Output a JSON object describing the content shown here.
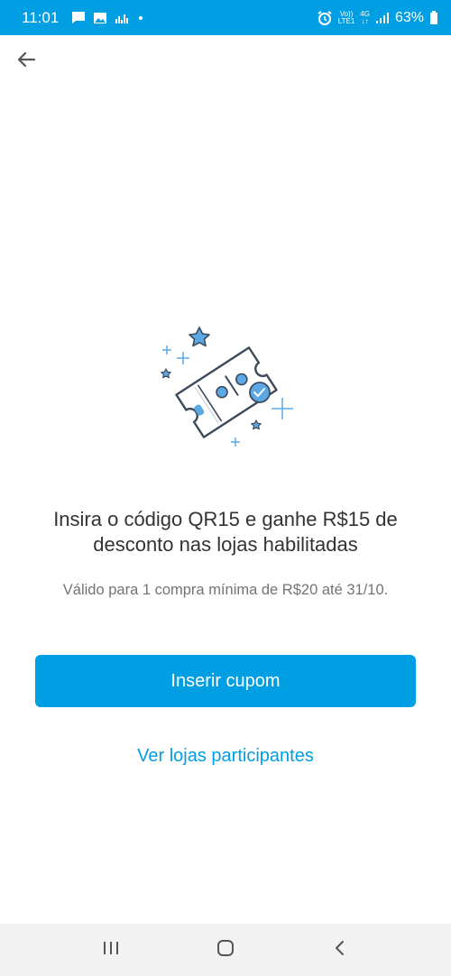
{
  "status_bar": {
    "time": "11:01",
    "network_top": "Vo))",
    "network_bottom": "LTE1",
    "network_type": "4G",
    "battery_percent": "63%",
    "left_icons": [
      "message-icon",
      "image-icon",
      "equalizer-icon",
      "dot-icon"
    ],
    "right_icons": [
      "alarm-icon",
      "volte-icon",
      "data-arrows-icon",
      "signal-icon",
      "battery-icon"
    ]
  },
  "app_bar": {
    "back_icon": "arrow-left-icon"
  },
  "illustration": {
    "icon": "coupon-ticket-icon",
    "accent": "#5aa9e6",
    "stroke": "#3d4a5c"
  },
  "content": {
    "headline": "Insira o código QR15 e ganhe R$15 de desconto nas lojas habilitadas",
    "subtext": "Válido para 1 compra mínima de R$20 até 31/10."
  },
  "actions": {
    "primary_label": "Inserir cupom",
    "secondary_label": "Ver lojas participantes"
  },
  "nav_bar": {
    "icons": [
      "recent-apps-icon",
      "home-icon",
      "back-nav-icon"
    ]
  },
  "colors": {
    "brand": "#009ee3",
    "headline": "#333333",
    "subtext": "#737373"
  }
}
